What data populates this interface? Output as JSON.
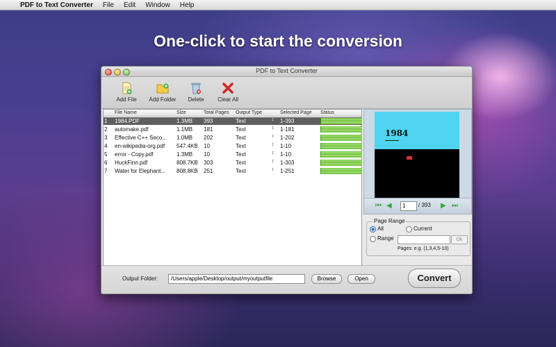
{
  "menubar": {
    "app": "PDF to Text Converter",
    "items": [
      "File",
      "Edit",
      "Window",
      "Help"
    ]
  },
  "headline": "One-click to start the conversion",
  "window": {
    "title": "PDF to Text Converter"
  },
  "toolbar": {
    "add_file": "Add File",
    "add_folder": "Add Folder",
    "delete": "Delete",
    "clear_all": "Clear All"
  },
  "table": {
    "headers": {
      "file_name": "File Name",
      "size": "Size",
      "total_pages": "Total Pages",
      "output_type": "Output Type",
      "selected_page": "Selected Page",
      "status": "Status"
    },
    "rows": [
      {
        "num": "1",
        "name": "1984.PDF",
        "size": "1.3MB",
        "pages": "393",
        "type": "Text",
        "range": "1-393"
      },
      {
        "num": "2",
        "name": "automake.pdf",
        "size": "1.1MB",
        "pages": "181",
        "type": "Text",
        "range": "1-181"
      },
      {
        "num": "3",
        "name": "Effective C++ Seco...",
        "size": "1.0MB",
        "pages": "202",
        "type": "Text",
        "range": "1-202"
      },
      {
        "num": "4",
        "name": "en-wikipedia-org.pdf",
        "size": "547.4KB",
        "pages": "10",
        "type": "Text",
        "range": "1-10"
      },
      {
        "num": "5",
        "name": "error - Copy.pdf",
        "size": "1.3MB",
        "pages": "10",
        "type": "Text",
        "range": "1-10"
      },
      {
        "num": "6",
        "name": "HuckFinn.pdf",
        "size": "808.7KB",
        "pages": "303",
        "type": "Text",
        "range": "1-303"
      },
      {
        "num": "7",
        "name": "Water for Elephant...",
        "size": "808.8KB",
        "pages": "251",
        "type": "Text",
        "range": "1-251"
      }
    ]
  },
  "preview": {
    "book_title": "1984",
    "current_page": "1",
    "total": "/  393"
  },
  "page_range": {
    "legend": "Page Range",
    "all": "All",
    "current": "Current",
    "range": "Range",
    "ok": "Ok",
    "hint": "Pages: e.g. (1,3,4,5-10)"
  },
  "output": {
    "label": "Output Folder:",
    "path": "/Users/apple/Desktop/output/myoutputfile",
    "browse": "Browse",
    "open": "Open",
    "convert": "Convert"
  }
}
